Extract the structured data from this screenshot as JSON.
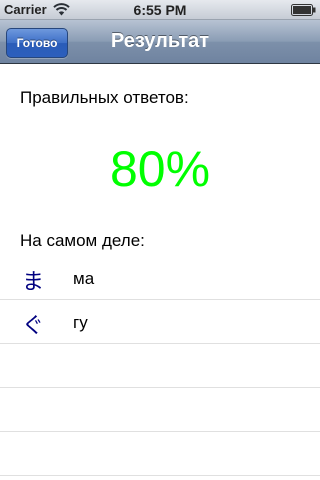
{
  "status_bar": {
    "carrier": "Carrier",
    "time": "6:55 PM",
    "wifi_icon": "wifi-icon",
    "battery_icon": "battery-icon"
  },
  "nav": {
    "done_label": "Готово",
    "title": "Результат"
  },
  "result": {
    "correct_label": "Правильных ответов:",
    "score": "80%",
    "score_color": "#00ff00",
    "actual_label": "На самом деле:"
  },
  "answers": [
    {
      "kana": "ま",
      "reading": "ма"
    },
    {
      "kana": "ぐ",
      "reading": "гу"
    }
  ],
  "colors": {
    "kana": "#000080",
    "nav_button": "#2c5fbd"
  }
}
